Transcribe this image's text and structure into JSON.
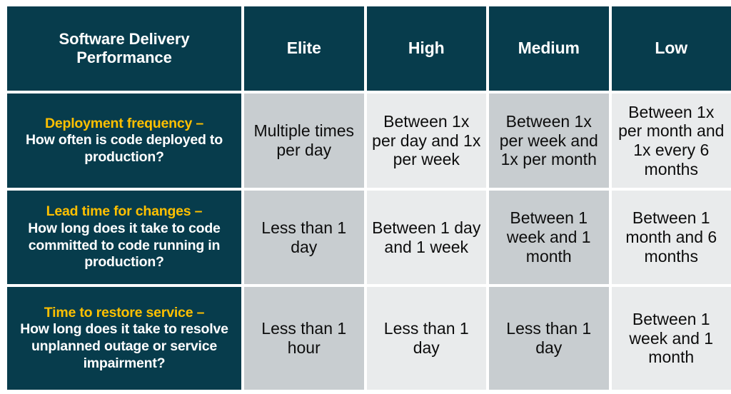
{
  "table": {
    "columns": [
      {
        "key": "metric",
        "label": "Software Delivery Performance"
      },
      {
        "key": "elite",
        "label": "Elite"
      },
      {
        "key": "high",
        "label": "High"
      },
      {
        "key": "medium",
        "label": "Medium"
      },
      {
        "key": "low",
        "label": "Low"
      }
    ],
    "rows": [
      {
        "metric_name": "Deployment frequency –",
        "metric_question": "How often is code deployed to production?",
        "elite": "Multiple times per day",
        "high": "Between 1x per day and 1x per week",
        "medium": "Between 1x per week and 1x per month",
        "low": "Between 1x per month and 1x every 6 months"
      },
      {
        "metric_name": "Lead time for changes –",
        "metric_question": "How long does it take to code committed to code running in production?",
        "elite": "Less than 1 day",
        "high": "Between 1 day and 1 week",
        "medium": "Between 1 week and 1 month",
        "low": "Between 1 month and 6 months"
      },
      {
        "metric_name": "Time to restore service –",
        "metric_question": "How long does it take to resolve unplanned outage or service impairment?",
        "elite": "Less than 1 hour",
        "high": "Less than 1 day",
        "medium": "Less than 1 day",
        "low": "Between 1 week and 1 month"
      }
    ]
  },
  "colors": {
    "header_background": "#073C4C",
    "metric_name_text": "#FFC000",
    "header_text": "#FFFFFF",
    "cell_shade_dark": "#C8CDD0",
    "cell_shade_light": "#E9EBEC",
    "body_text": "#0D0D0D",
    "page_background": "#FFFFFF"
  }
}
